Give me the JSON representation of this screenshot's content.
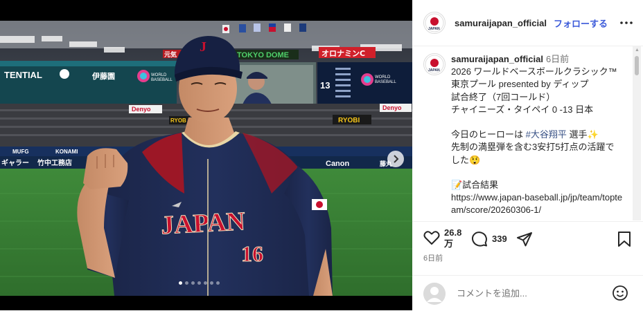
{
  "post": {
    "username": "samuraijapan_official",
    "follow_label": "フォローする",
    "time_ago": "6日前",
    "caption_lines": [
      "2026 ワールドベースボールクラシック™ 東京プール presented by ディップ",
      "試合終了（7回コールド）",
      "チャイニーズ・タイペイ 0 -13 日本",
      "",
      "今日のヒーローは #大谷翔平 選手✨",
      "先制の満塁弾を含む3安打5打点の活躍でした😲",
      "",
      "📝試合結果",
      "https://www.japan-baseball.jp/jp/team/topteam/score/20260306-1/"
    ],
    "caption_parts": {
      "hero_prefix": "今日のヒーローは ",
      "hashtag": "#大谷翔平",
      "hero_suffix": " 選手✨"
    },
    "likes": "26.8万",
    "likes_line1": "26.8",
    "likes_line2": "万",
    "comments_count": "339",
    "date": "6日前",
    "comment_placeholder": "コメントを追加...",
    "image": {
      "banner_brand_1": "TENTIAL",
      "banner_brand_2": "伊藤園",
      "banner_wbc": "WORLD BASEBALL CLASSIC",
      "stadium": "TOKYO DOME",
      "sign_1": "オロナミンC",
      "sign_2": "元気",
      "sign_3": "Denyo",
      "sign_4": "RYOBI",
      "sign_5": "Canon",
      "sign_6": "竹中工務店",
      "sign_7": "MUFG",
      "sign_8": "KONAMI",
      "sign_9": "ギャラー",
      "sign_10": "藤丸",
      "sign_11": "RYOB",
      "score_number": "13",
      "jersey_text": "JAPAN",
      "jersey_number": "16",
      "cap_letter": "J",
      "logo_text": "JAPAN"
    },
    "carousel": {
      "total": 7,
      "active": 1
    }
  },
  "colors": {
    "accent_link": "#3a59d9",
    "hashtag": "#385185",
    "jersey_navy": "#1e2a4f",
    "jersey_red": "#c8102e"
  },
  "icons": [
    "more-icon",
    "next-icon",
    "heart-icon",
    "comment-icon",
    "share-icon",
    "bookmark-icon",
    "emoji-icon",
    "avatar-icon"
  ]
}
